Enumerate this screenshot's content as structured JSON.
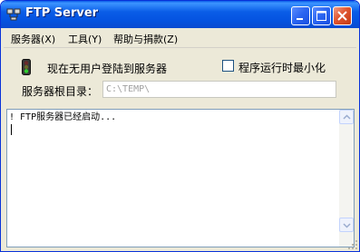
{
  "window": {
    "title": "FTP Server",
    "accent_color": "#0a5de7",
    "close_color": "#e0552f"
  },
  "menu": {
    "items": [
      {
        "label": "服务器(X)"
      },
      {
        "label": "工具(Y)"
      },
      {
        "label": "帮助与捐款(Z)"
      }
    ]
  },
  "status": {
    "icon": "traffic-light-icon",
    "text": "现在无用户登陆到服务器"
  },
  "options": {
    "minimize_label": "程序运行时最小化",
    "minimize_checked": false
  },
  "root_dir": {
    "label": "服务器根目录：",
    "value": "C:\\TEMP\\"
  },
  "log": {
    "text": "! FTP服务器已经启动..."
  }
}
